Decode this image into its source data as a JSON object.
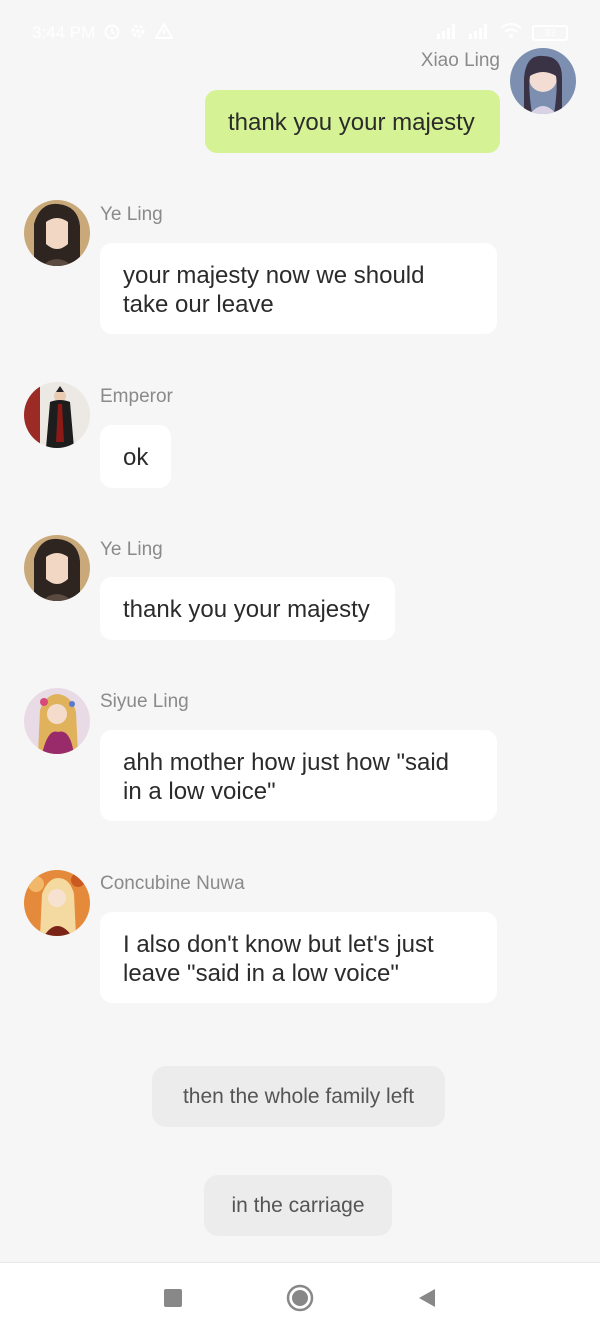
{
  "status_bar": {
    "time": "3:44 PM",
    "battery": "33"
  },
  "messages": [
    {
      "sender": "Xiao Ling",
      "text": "thank you your majesty",
      "side": "right",
      "avatar": "xiao-ling-avatar"
    },
    {
      "sender": "Ye Ling",
      "text": "your majesty now we should take our leave",
      "side": "left",
      "avatar": "ye-ling-avatar"
    },
    {
      "sender": "Emperor",
      "text": "ok",
      "side": "left",
      "avatar": "emperor-avatar"
    },
    {
      "sender": "Ye Ling",
      "text": "thank you your majesty",
      "side": "left",
      "avatar": "ye-ling-avatar"
    },
    {
      "sender": "Siyue Ling",
      "text": "ahh mother how just how \"said in a low voice\"",
      "side": "left",
      "avatar": "siyue-ling-avatar"
    },
    {
      "sender": "Concubine Nuwa",
      "text": "I also don't know but let's just leave \"said in a low voice\"",
      "side": "left",
      "avatar": "concubine-nuwa-avatar"
    }
  ],
  "narrations": [
    "then the whole family left",
    "in the carriage"
  ],
  "colors": {
    "background": "#f6f6f6",
    "my_bubble": "#d5f394",
    "other_bubble": "#ffffff",
    "narration_bg": "#ececec",
    "name_text": "#8a8a8a"
  },
  "nav_icons": [
    "recent-apps-icon",
    "home-icon",
    "back-icon"
  ]
}
